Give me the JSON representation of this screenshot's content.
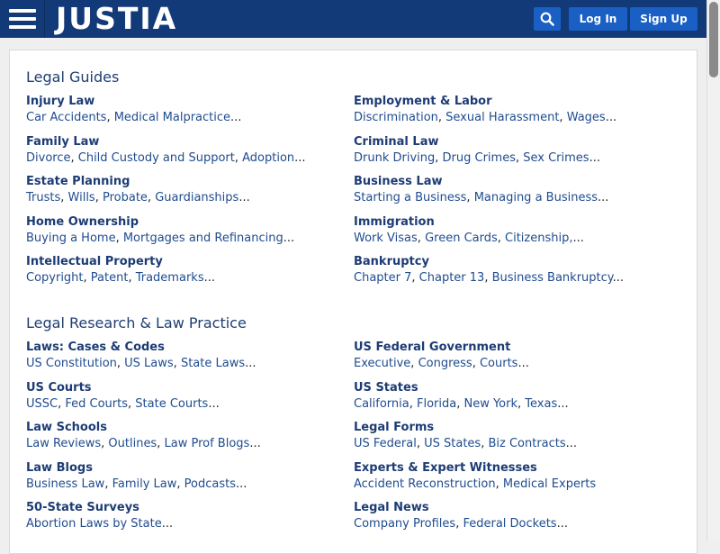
{
  "header": {
    "logo": "JUSTIA",
    "login_label": "Log In",
    "signup_label": "Sign Up"
  },
  "icons": {
    "menu": "hamburger-icon",
    "search": "search-icon"
  },
  "colors": {
    "header_bg": "#133a78",
    "button_bg": "#1a5fc4",
    "title": "#1d3c75",
    "link": "#1f4c8f"
  },
  "legal_guides": {
    "title": "Legal Guides",
    "items": [
      {
        "title": "Injury Law",
        "links": [
          "Car Accidents",
          "Medical Malpractice"
        ]
      },
      {
        "title": "Employment & Labor",
        "links": [
          "Discrimination",
          "Sexual Harassment",
          "Wages"
        ]
      },
      {
        "title": "Family Law",
        "links": [
          "Divorce",
          "Child Custody and Support",
          "Adoption"
        ]
      },
      {
        "title": "Criminal Law",
        "links": [
          "Drunk Driving",
          "Drug Crimes",
          "Sex Crimes"
        ]
      },
      {
        "title": "Estate Planning",
        "links": [
          "Trusts",
          "Wills",
          "Probate",
          "Guardianships"
        ]
      },
      {
        "title": "Business Law",
        "links": [
          "Starting a Business",
          "Managing a Business"
        ]
      },
      {
        "title": "Home Ownership",
        "links": [
          "Buying a Home",
          "Mortgages and Refinancing"
        ]
      },
      {
        "title": "Immigration",
        "links": [
          "Work Visas",
          "Green Cards",
          "Citizenship,"
        ]
      },
      {
        "title": "Intellectual Property",
        "links": [
          "Copyright",
          "Patent",
          "Trademarks"
        ]
      },
      {
        "title": "Bankruptcy",
        "links": [
          "Chapter 7",
          "Chapter 13",
          "Business Bankruptcy"
        ]
      }
    ]
  },
  "legal_research": {
    "title": "Legal Research & Law Practice",
    "items": [
      {
        "title": "Laws: Cases & Codes",
        "links": [
          "US Constitution",
          "US Laws",
          "State Laws"
        ]
      },
      {
        "title": "US Federal Government",
        "links": [
          "Executive",
          "Congress",
          "Courts"
        ]
      },
      {
        "title": "US Courts",
        "links": [
          "USSC",
          "Fed Courts",
          "State Courts"
        ]
      },
      {
        "title": "US States",
        "links": [
          "California",
          "Florida",
          "New York",
          "Texas"
        ]
      },
      {
        "title": "Law Schools",
        "links": [
          "Law Reviews",
          "Outlines",
          "Law Prof Blogs"
        ]
      },
      {
        "title": "Legal Forms",
        "links": [
          "US Federal",
          "US States",
          "Biz Contracts"
        ]
      },
      {
        "title": "Law Blogs",
        "links": [
          "Business Law",
          "Family Law",
          "Podcasts"
        ]
      },
      {
        "title": "Experts & Expert Witnesses",
        "links": [
          "Accident Reconstruction",
          "Medical Experts"
        ],
        "no_ellipsis": true
      },
      {
        "title": "50-State Surveys",
        "links": [
          "Abortion Laws by State"
        ]
      },
      {
        "title": "Legal News",
        "links": [
          "Company Profiles",
          "Federal Dockets"
        ]
      }
    ]
  },
  "ellipsis": "..."
}
